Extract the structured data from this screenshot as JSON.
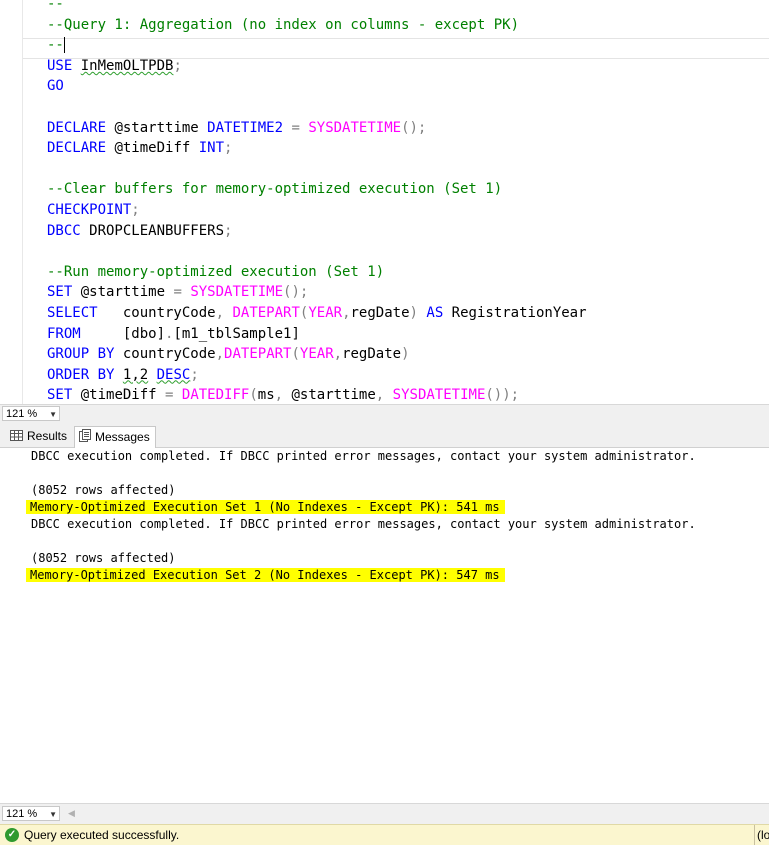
{
  "editor": {
    "lines": [
      [
        {
          "t": "--",
          "c": "cmt"
        }
      ],
      [
        {
          "t": "--Query 1: Aggregation (no index on columns - except PK)",
          "c": "cmt"
        }
      ],
      [
        {
          "t": "--",
          "c": "cmt"
        }
      ],
      [
        {
          "t": "USE",
          "c": "kw"
        },
        {
          "t": " "
        },
        {
          "t": "InMemOLTPDB",
          "c": "squig"
        },
        {
          "t": ";",
          "c": "gr"
        }
      ],
      [
        {
          "t": "GO",
          "c": "kw"
        }
      ],
      [
        {
          "t": ""
        }
      ],
      [
        {
          "t": "DECLARE",
          "c": "kw"
        },
        {
          "t": " @starttime "
        },
        {
          "t": "DATETIME2",
          "c": "kw"
        },
        {
          "t": " "
        },
        {
          "t": "=",
          "c": "gr"
        },
        {
          "t": " "
        },
        {
          "t": "SYSDATETIME",
          "c": "fn"
        },
        {
          "t": "();",
          "c": "gr"
        }
      ],
      [
        {
          "t": "DECLARE",
          "c": "kw"
        },
        {
          "t": " @timeDiff "
        },
        {
          "t": "INT",
          "c": "kw"
        },
        {
          "t": ";",
          "c": "gr"
        }
      ],
      [
        {
          "t": ""
        }
      ],
      [
        {
          "t": "--Clear buffers for memory-optimized execution (Set 1)",
          "c": "cmt"
        }
      ],
      [
        {
          "t": "CHECKPOINT",
          "c": "kw"
        },
        {
          "t": ";",
          "c": "gr"
        }
      ],
      [
        {
          "t": "DBCC",
          "c": "kw"
        },
        {
          "t": " DROPCLEANBUFFERS"
        },
        {
          "t": ";",
          "c": "gr"
        }
      ],
      [
        {
          "t": ""
        }
      ],
      [
        {
          "t": "--Run memory-optimized execution (Set 1)",
          "c": "cmt"
        }
      ],
      [
        {
          "t": "SET",
          "c": "kw"
        },
        {
          "t": " @starttime "
        },
        {
          "t": "=",
          "c": "gr"
        },
        {
          "t": " "
        },
        {
          "t": "SYSDATETIME",
          "c": "fn"
        },
        {
          "t": "();",
          "c": "gr"
        }
      ],
      [
        {
          "t": "SELECT",
          "c": "kw"
        },
        {
          "t": "   countryCode"
        },
        {
          "t": ",",
          "c": "gr"
        },
        {
          "t": " "
        },
        {
          "t": "DATEPART",
          "c": "fn"
        },
        {
          "t": "(",
          "c": "gr"
        },
        {
          "t": "YEAR",
          "c": "fn"
        },
        {
          "t": ",",
          "c": "gr"
        },
        {
          "t": "regDate"
        },
        {
          "t": ")",
          "c": "gr"
        },
        {
          "t": " "
        },
        {
          "t": "AS",
          "c": "kw"
        },
        {
          "t": " RegistrationYear"
        }
      ],
      [
        {
          "t": "FROM",
          "c": "kw"
        },
        {
          "t": "     [dbo]"
        },
        {
          "t": ".",
          "c": "gr"
        },
        {
          "t": "[m1_tblSample1]"
        }
      ],
      [
        {
          "t": "GROUP",
          "c": "kw"
        },
        {
          "t": " "
        },
        {
          "t": "BY",
          "c": "kw"
        },
        {
          "t": " countryCode"
        },
        {
          "t": ",",
          "c": "gr"
        },
        {
          "t": "DATEPART",
          "c": "fn"
        },
        {
          "t": "(",
          "c": "gr"
        },
        {
          "t": "YEAR",
          "c": "fn"
        },
        {
          "t": ",",
          "c": "gr"
        },
        {
          "t": "regDate"
        },
        {
          "t": ")",
          "c": "gr"
        }
      ],
      [
        {
          "t": "ORDER",
          "c": "kw"
        },
        {
          "t": " "
        },
        {
          "t": "BY",
          "c": "kw"
        },
        {
          "t": " "
        },
        {
          "t": "1,2",
          "c": "squig"
        },
        {
          "t": " "
        },
        {
          "t": "DESC",
          "c": "kw squig"
        },
        {
          "t": ";",
          "c": "gr"
        }
      ],
      [
        {
          "t": "SET",
          "c": "kw"
        },
        {
          "t": " @timeDiff "
        },
        {
          "t": "=",
          "c": "gr"
        },
        {
          "t": " "
        },
        {
          "t": "DATEDIFF",
          "c": "fn"
        },
        {
          "t": "(",
          "c": "gr"
        },
        {
          "t": "ms"
        },
        {
          "t": ",",
          "c": "gr"
        },
        {
          "t": " @starttime"
        },
        {
          "t": ",",
          "c": "gr"
        },
        {
          "t": " "
        },
        {
          "t": "SYSDATETIME",
          "c": "fn"
        },
        {
          "t": "());",
          "c": "gr"
        }
      ]
    ]
  },
  "zoom": {
    "editor": "121 %",
    "results": "121 %"
  },
  "tabs": {
    "results": "Results",
    "messages": "Messages"
  },
  "messages": [
    {
      "text": "DBCC execution completed. If DBCC printed error messages, contact your system administrator.",
      "highlight": false
    },
    {
      "text": "",
      "highlight": false
    },
    {
      "text": "(8052 rows affected)",
      "highlight": false
    },
    {
      "text": "Memory-Optimized Execution Set 1 (No Indexes - Except PK): 541 ms",
      "highlight": true
    },
    {
      "text": "DBCC execution completed. If DBCC printed error messages, contact your system administrator.",
      "highlight": false
    },
    {
      "text": "",
      "highlight": false
    },
    {
      "text": "(8052 rows affected)",
      "highlight": false
    },
    {
      "text": "Memory-Optimized Execution Set 2 (No Indexes - Except PK): 547 ms",
      "highlight": true
    }
  ],
  "status": {
    "text": "Query executed successfully.",
    "right": "(lo"
  },
  "colors": {
    "highlight": "#ffff00",
    "comment": "#008000",
    "keyword": "#0000ff",
    "function": "#ff00ff",
    "status_bg": "#fbf6cf"
  }
}
